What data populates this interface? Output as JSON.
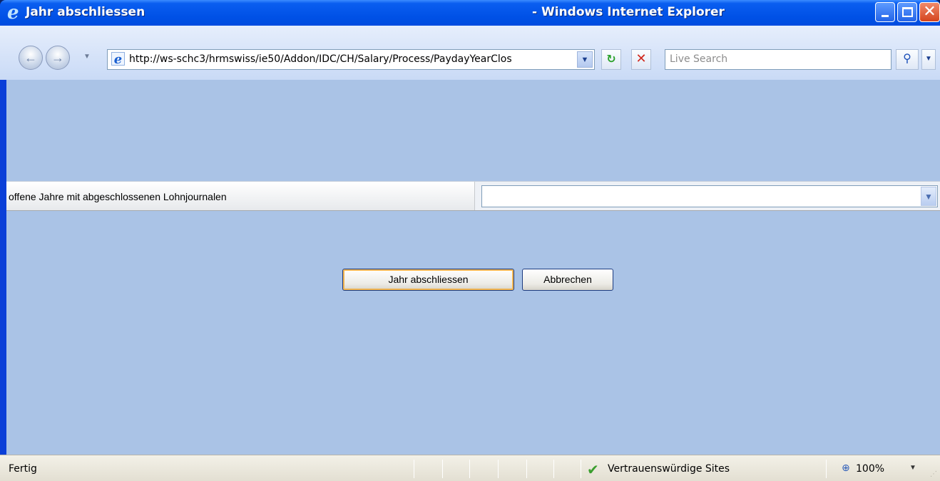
{
  "window": {
    "title_page": "Jahr abschliessen",
    "title_app": "- Windows Internet Explorer",
    "minimize_glyph": "",
    "close_glyph": "✕"
  },
  "navbar": {
    "address_url": "http://ws-schc3/hrmswiss/ie50/Addon/IDC/CH/Salary/Process/PaydayYearClos",
    "search_placeholder": "Live Search",
    "back_glyph": "←",
    "forward_glyph": "→",
    "drop_glyph": "▼",
    "refresh_glyph": "↻",
    "stop_glyph": "✕",
    "search_glyph": "⚲",
    "ie_glyph": "e"
  },
  "form": {
    "label": "offene Jahre mit abgeschlossenen Lohnjournalen",
    "select_value": "",
    "select_arrow_glyph": "▼",
    "submit_label": "Jahr abschliessen",
    "cancel_label": "Abbrechen"
  },
  "status": {
    "text": "Fertig",
    "zone": "Vertrauenswürdige Sites",
    "zoom": "100%",
    "check_glyph": "✔",
    "zoom_glyph": "⊕",
    "zoom_drop_glyph": "▼",
    "grip_glyph": "⋰"
  },
  "icons": {
    "ie-logo-icon": "e",
    "back-icon": "arrow-left",
    "forward-icon": "arrow-right",
    "refresh-icon": "refresh-arrows",
    "stop-icon": "x",
    "search-icon": "magnifier",
    "trusted-zone-icon": "green-check",
    "zoom-icon": "magnifier-plus"
  },
  "colors": {
    "titlebar": "#0051e6",
    "content_bg": "#aac3e6",
    "button_focus": "#f3b651"
  }
}
